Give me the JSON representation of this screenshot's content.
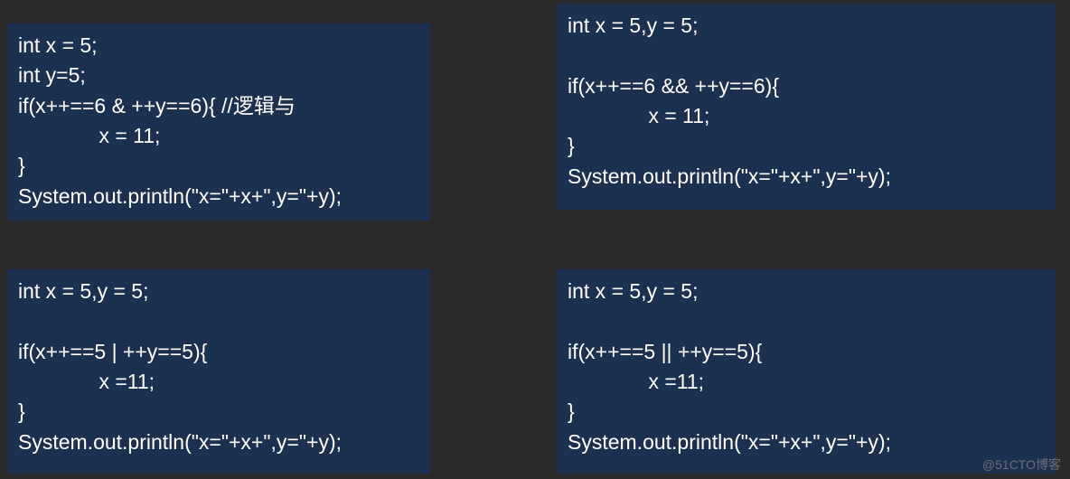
{
  "codeBlocks": {
    "topLeft": "int x = 5;\nint y=5;\nif(x++==6 & ++y==6){ //逻辑与\n              x = 11;\n}\nSystem.out.println(\"x=\"+x+\",y=\"+y);",
    "topRight": "int x = 5,y = 5;\n\nif(x++==6 && ++y==6){\n              x = 11;\n}\nSystem.out.println(\"x=\"+x+\",y=\"+y);",
    "bottomLeft": "int x = 5,y = 5;\n\nif(x++==5 | ++y==5){\n              x =11;\n}\nSystem.out.println(\"x=\"+x+\",y=\"+y);",
    "bottomRight": "int x = 5,y = 5;\n\nif(x++==5 || ++y==5){\n              x =11;\n}\nSystem.out.println(\"x=\"+x+\",y=\"+y);"
  },
  "watermark": "@51CTO博客"
}
